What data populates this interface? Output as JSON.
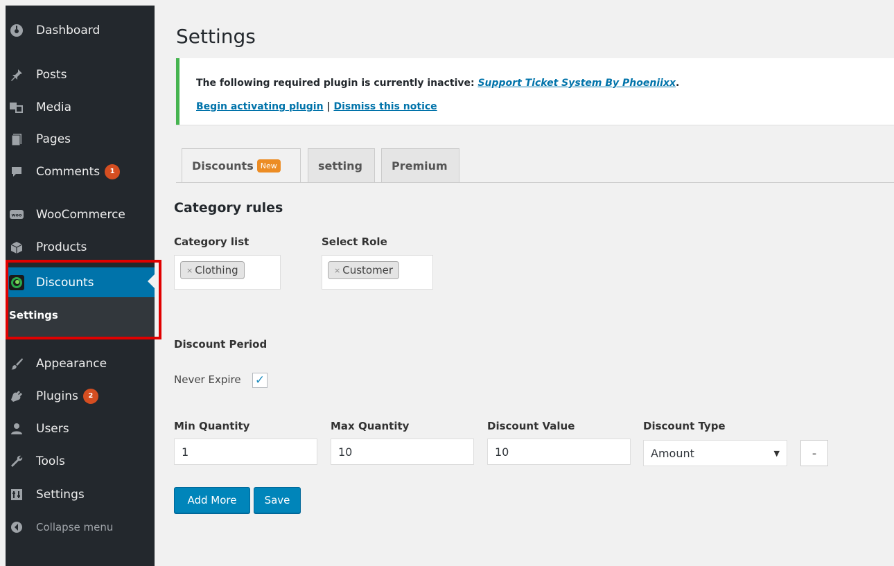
{
  "sidebar": {
    "items": [
      {
        "label": "Dashboard",
        "icon": "dashboard-icon"
      },
      {
        "label": "Posts",
        "icon": "pin-icon"
      },
      {
        "label": "Media",
        "icon": "media-icon"
      },
      {
        "label": "Pages",
        "icon": "pages-icon"
      },
      {
        "label": "Comments",
        "icon": "comment-icon",
        "badge": "1"
      },
      {
        "label": "WooCommerce",
        "icon": "woo-icon"
      },
      {
        "label": "Products",
        "icon": "box-icon"
      },
      {
        "label": "Discounts",
        "icon": "discounts-logo-icon"
      },
      {
        "label": "Appearance",
        "icon": "brush-icon"
      },
      {
        "label": "Plugins",
        "icon": "plug-icon",
        "badge": "2"
      },
      {
        "label": "Users",
        "icon": "users-icon"
      },
      {
        "label": "Tools",
        "icon": "wrench-icon"
      },
      {
        "label": "Settings",
        "icon": "settings-icon"
      },
      {
        "label": "Collapse menu",
        "icon": "collapse-icon"
      }
    ],
    "submenu": {
      "label": "Settings"
    }
  },
  "page": {
    "title": "Settings"
  },
  "notice": {
    "text": "The following required plugin is currently inactive: ",
    "plugin_link": "Support Ticket System By Phoeniixx",
    "period": ".",
    "activate_link": "Begin activating plugin",
    "separator": " | ",
    "dismiss_link": "Dismiss this notice"
  },
  "tabs": [
    {
      "label": "Discounts",
      "badge": "New"
    },
    {
      "label": "setting"
    },
    {
      "label": "Premium"
    }
  ],
  "form": {
    "heading": "Category rules",
    "category_label": "Category list",
    "category_value": "Clothing",
    "role_label": "Select Role",
    "role_value": "Customer",
    "token_remove": "×",
    "period_label": "Discount Period",
    "never_expire_label": "Never Expire",
    "checkbox_mark": "✓",
    "min_label": "Min Quantity",
    "min_value": "1",
    "max_label": "Max Quantity",
    "max_value": "10",
    "value_label": "Discount Value",
    "value_value": "10",
    "type_label": "Discount Type",
    "type_value": "Amount",
    "dropdown_arrow": "▼",
    "remove_label": "-",
    "add_more_label": "Add More",
    "save_label": "Save"
  },
  "colors": {
    "sidebar_bg": "#23282d",
    "active_bg": "#0073aa",
    "notice_border": "#46b450",
    "badge": "#d54e21",
    "tab_badge": "#ec8c24",
    "button": "#0085ba",
    "highlight": "#e00000"
  }
}
